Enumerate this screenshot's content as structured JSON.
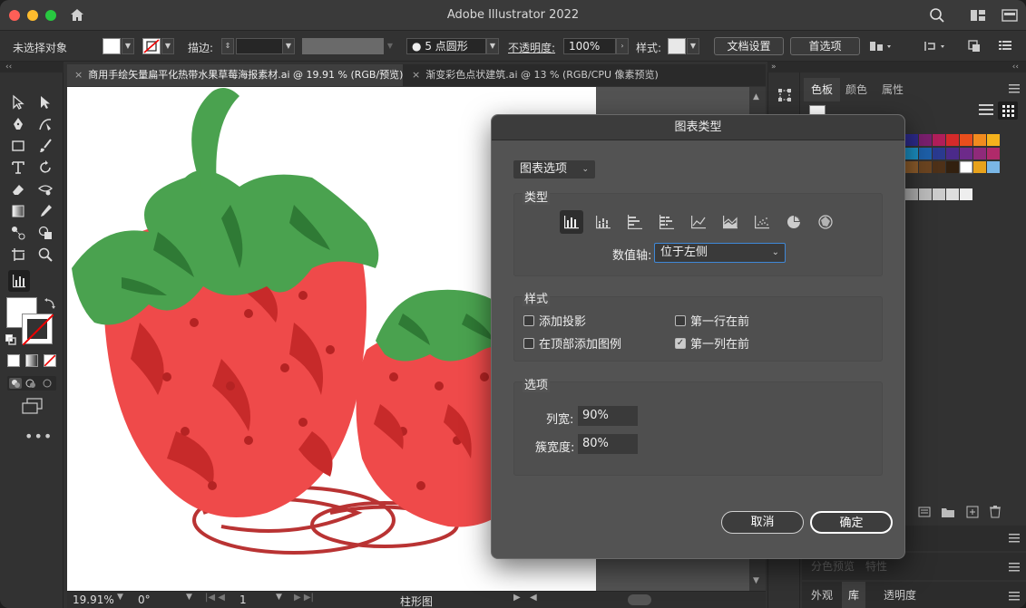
{
  "app": {
    "title": "Adobe Illustrator 2022"
  },
  "control_bar": {
    "selection": "未选择对象",
    "stroke_label": "描边:",
    "brush": "5 点圆形",
    "opacity_label": "不透明度:",
    "opacity_value": "100%",
    "style_label": "样式:",
    "doc_settings": "文档设置",
    "preferences": "首选项"
  },
  "tabs": [
    {
      "label": "商用手绘矢量扁平化热带水果草莓海报素材.ai @ 19.91 % (RGB/预览)",
      "active": true
    },
    {
      "label": "渐变彩色点状建筑.ai @ 13 % (RGB/CPU 像素预览)",
      "active": false
    }
  ],
  "statusbar": {
    "zoom": "19.91%",
    "rotation": "0°",
    "artboard_num": "1",
    "tool_name": "柱形图"
  },
  "right_panel": {
    "tabs": [
      "色板",
      "颜色",
      "属性"
    ],
    "bottom_tabs": [
      "分色预览",
      "特性"
    ],
    "bottom_tabs2": [
      "外观",
      "库",
      "透明度"
    ]
  },
  "dialog": {
    "title": "图表类型",
    "options_dropdown": "图表选项",
    "type_group": "类型",
    "chart_types": [
      "柱形图",
      "堆积柱形图",
      "条形图",
      "堆积条形图",
      "折线图",
      "面积图",
      "散点图",
      "饼图",
      "雷达图"
    ],
    "value_axis_label": "数值轴:",
    "value_axis_value": "位于左侧",
    "style_group": "样式",
    "checkboxes": [
      {
        "label": "添加投影",
        "checked": false
      },
      {
        "label": "第一行在前",
        "checked": false
      },
      {
        "label": "在顶部添加图例",
        "checked": false
      },
      {
        "label": "第一列在前",
        "checked": true
      }
    ],
    "options_group": "选项",
    "column_width_label": "列宽:",
    "column_width_value": "90%",
    "cluster_width_label": "簇宽度:",
    "cluster_width_value": "80%",
    "cancel": "取消",
    "ok": "确定"
  },
  "colors": {
    "accent_blue": "#3f88d7",
    "strawberry_red": "#ef4a4a",
    "leaf_green": "#4aa24f"
  }
}
